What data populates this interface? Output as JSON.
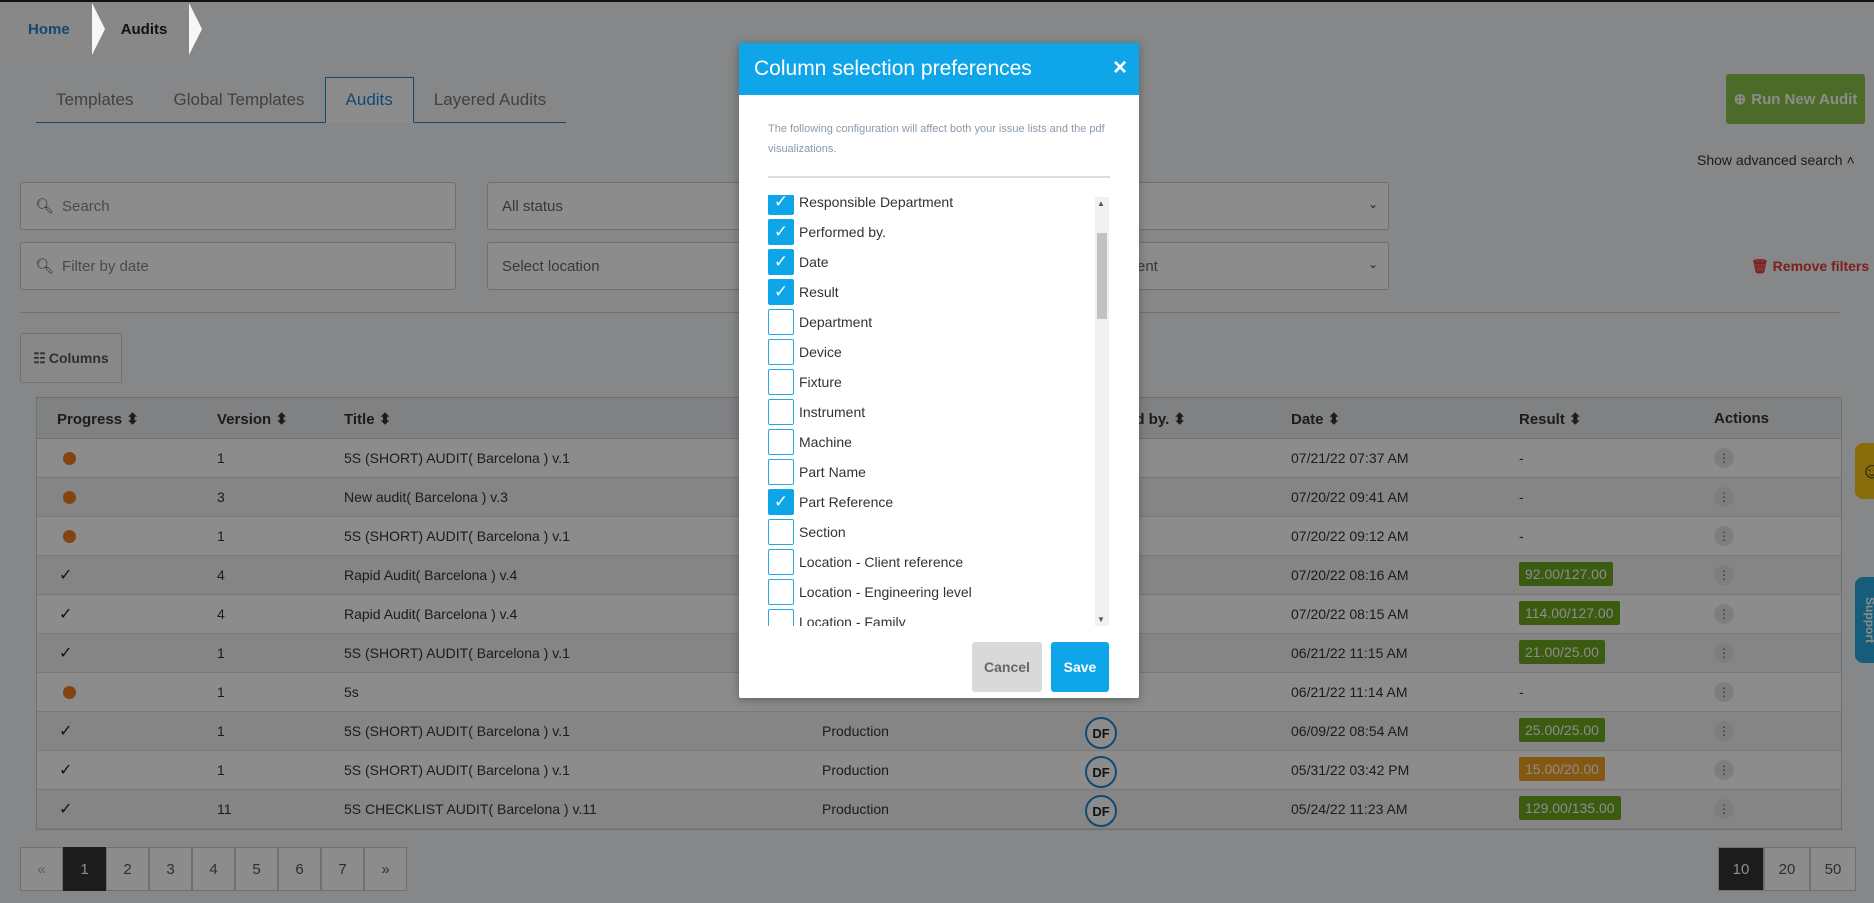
{
  "breadcrumb": {
    "home": "Home",
    "current": "Audits"
  },
  "tabs": [
    "Templates",
    "Global Templates",
    "Audits",
    "Layered Audits"
  ],
  "run_button": "Run New Audit",
  "advanced_search": "Show advanced search",
  "filters": {
    "search_placeholder": "Search",
    "status": "All status",
    "date_placeholder": "Filter by date",
    "location": "Select location",
    "department_partial": "ent",
    "remove": "Remove filters"
  },
  "columns_button": "Columns",
  "table": {
    "headers": [
      "Progress",
      "Version",
      "Title",
      "ed by.",
      "Date",
      "Result",
      "Actions"
    ],
    "rows": [
      {
        "progress": "dot",
        "version": "1",
        "title": "5S (SHORT) AUDIT( Barcelona ) v.1",
        "dept": "",
        "avatar": "",
        "date": "07/21/22 07:37 AM",
        "result": "-",
        "badge": ""
      },
      {
        "progress": "dot",
        "version": "3",
        "title": "New audit( Barcelona ) v.3",
        "dept": "",
        "avatar": "",
        "date": "07/20/22 09:41 AM",
        "result": "-",
        "badge": ""
      },
      {
        "progress": "dot",
        "version": "1",
        "title": "5S (SHORT) AUDIT( Barcelona ) v.1",
        "dept": "",
        "avatar": "",
        "date": "07/20/22 09:12 AM",
        "result": "-",
        "badge": ""
      },
      {
        "progress": "check",
        "version": "4",
        "title": "Rapid Audit( Barcelona ) v.4",
        "dept": "",
        "avatar": "",
        "date": "07/20/22 08:16 AM",
        "result": "92.00/127.00",
        "badge": "green"
      },
      {
        "progress": "check",
        "version": "4",
        "title": "Rapid Audit( Barcelona ) v.4",
        "dept": "",
        "avatar": "",
        "date": "07/20/22 08:15 AM",
        "result": "114.00/127.00",
        "badge": "green"
      },
      {
        "progress": "check",
        "version": "1",
        "title": "5S (SHORT) AUDIT( Barcelona ) v.1",
        "dept": "",
        "avatar": "",
        "date": "06/21/22 11:15 AM",
        "result": "21.00/25.00",
        "badge": "green"
      },
      {
        "progress": "dot",
        "version": "1",
        "title": "5s",
        "dept": "",
        "avatar": "",
        "date": "06/21/22 11:14 AM",
        "result": "-",
        "badge": ""
      },
      {
        "progress": "check",
        "version": "1",
        "title": "5S (SHORT) AUDIT( Barcelona ) v.1",
        "dept": "Production",
        "avatar": "DF",
        "date": "06/09/22 08:54 AM",
        "result": "25.00/25.00",
        "badge": "green"
      },
      {
        "progress": "check",
        "version": "1",
        "title": "5S (SHORT) AUDIT( Barcelona ) v.1",
        "dept": "Production",
        "avatar": "DF",
        "date": "05/31/22 03:42 PM",
        "result": "15.00/20.00",
        "badge": "orange"
      },
      {
        "progress": "check",
        "version": "11",
        "title": "5S CHECKLIST AUDIT( Barcelona ) v.11",
        "dept": "Production",
        "avatar": "DF",
        "date": "05/24/22 11:23 AM",
        "result": "129.00/135.00",
        "badge": "green"
      }
    ]
  },
  "pagination": {
    "prev": "«",
    "pages": [
      "1",
      "2",
      "3",
      "4",
      "5",
      "6",
      "7"
    ],
    "next": "»",
    "active": "1"
  },
  "page_sizes": {
    "options": [
      "10",
      "20",
      "50"
    ],
    "active": "10"
  },
  "support": "Support",
  "modal": {
    "title": "Column selection preferences",
    "close": "×",
    "description": "The following configuration will affect both your issue lists and the pdf visualizations.",
    "items": [
      {
        "label": "Responsible Department",
        "checked": true
      },
      {
        "label": "Performed by.",
        "checked": true
      },
      {
        "label": "Date",
        "checked": true
      },
      {
        "label": "Result",
        "checked": true
      },
      {
        "label": "Department",
        "checked": false
      },
      {
        "label": "Device",
        "checked": false
      },
      {
        "label": "Fixture",
        "checked": false
      },
      {
        "label": "Instrument",
        "checked": false
      },
      {
        "label": "Machine",
        "checked": false
      },
      {
        "label": "Part Name",
        "checked": false
      },
      {
        "label": "Part Reference",
        "checked": true
      },
      {
        "label": "Section",
        "checked": false
      },
      {
        "label": "Location - Client reference",
        "checked": false
      },
      {
        "label": "Location - Engineering level",
        "checked": false
      },
      {
        "label": "Location - Family",
        "checked": false
      }
    ],
    "cancel": "Cancel",
    "save": "Save"
  }
}
